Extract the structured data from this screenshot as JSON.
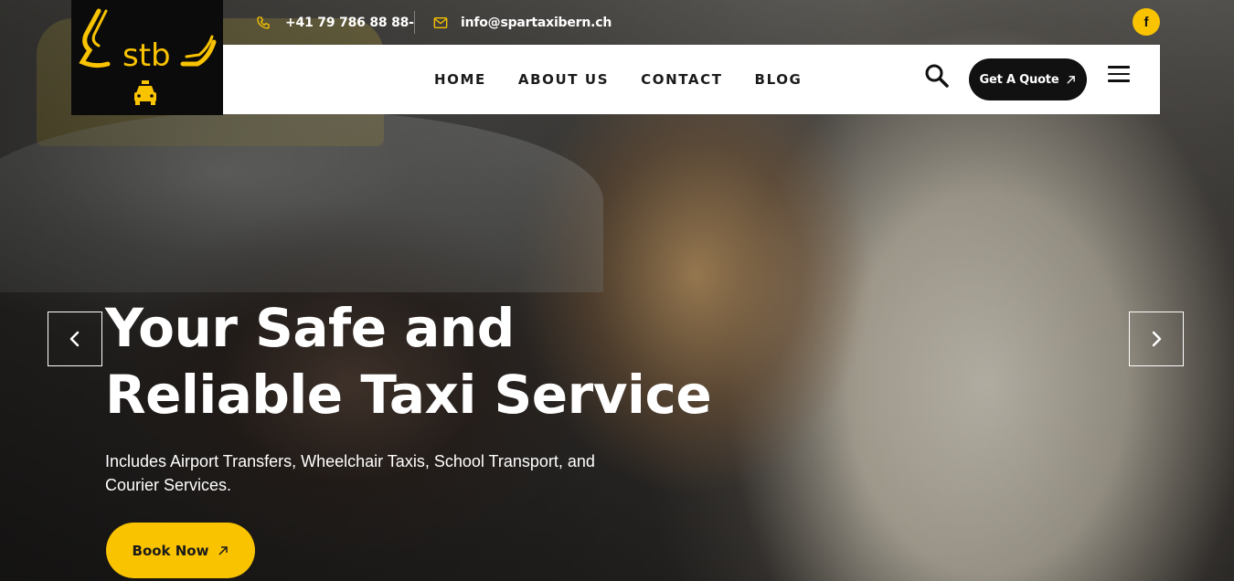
{
  "brand": {
    "logo_text": "stb",
    "accent_color": "#f9c300"
  },
  "topbar": {
    "phone": "+41 79 786 88 88-",
    "email": "info@spartaxibern.ch",
    "social": "f"
  },
  "nav": {
    "items": [
      "HOME",
      "ABOUT US",
      "CONTACT",
      "BLOG"
    ],
    "quote_label": "Get A Quote"
  },
  "hero": {
    "headline_line1": "Your Safe and",
    "headline_line2": "Reliable Taxi Service",
    "subtext": "Includes Airport Transfers, Wheelchair Taxis, School Transport, and Courier Services.",
    "cta_label": "Book Now"
  },
  "icons": {
    "phone": "phone-icon",
    "email": "envelope-icon",
    "facebook": "facebook-icon",
    "search": "search-icon",
    "menu": "hamburger-menu-icon",
    "prev": "chevron-left-icon",
    "next": "chevron-right-icon",
    "arrow": "arrow-up-right-icon",
    "taxi": "taxi-car-icon"
  }
}
